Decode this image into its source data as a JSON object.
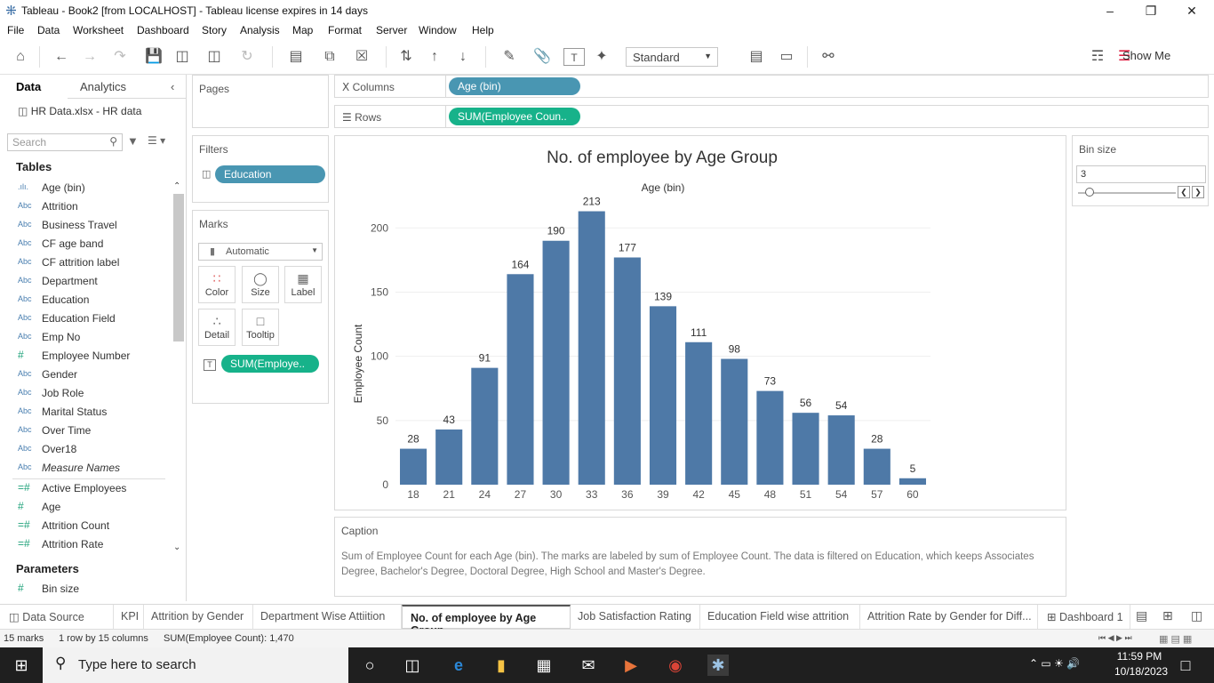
{
  "window": {
    "title": "Tableau - Book2 [from LOCALHOST] - Tableau license expires in 14 days"
  },
  "menu": [
    "File",
    "Data",
    "Worksheet",
    "Dashboard",
    "Story",
    "Analysis",
    "Map",
    "Format",
    "Server",
    "Window",
    "Help"
  ],
  "toolbar": {
    "fit": "Standard",
    "show_me": "Show Me"
  },
  "data_pane": {
    "tabs": {
      "data": "Data",
      "analytics": "Analytics"
    },
    "datasource": "HR Data.xlsx - HR data",
    "search_placeholder": "Search",
    "tables_heading": "Tables",
    "fields": [
      {
        "type": ".ılı.",
        "name": "Age (bin)"
      },
      {
        "type": "Abc",
        "name": "Attrition"
      },
      {
        "type": "Abc",
        "name": "Business Travel"
      },
      {
        "type": "Abc",
        "name": "CF age band"
      },
      {
        "type": "Abc",
        "name": "CF attrition label"
      },
      {
        "type": "Abc",
        "name": "Department"
      },
      {
        "type": "Abc",
        "name": "Education"
      },
      {
        "type": "Abc",
        "name": "Education Field"
      },
      {
        "type": "Abc",
        "name": "Emp No"
      },
      {
        "type": "#",
        "name": "Employee Number"
      },
      {
        "type": "Abc",
        "name": "Gender"
      },
      {
        "type": "Abc",
        "name": "Job Role"
      },
      {
        "type": "Abc",
        "name": "Marital Status"
      },
      {
        "type": "Abc",
        "name": "Over Time"
      },
      {
        "type": "Abc",
        "name": "Over18"
      },
      {
        "type": "Abc",
        "name": "Measure Names"
      }
    ],
    "measures": [
      {
        "type": "=#",
        "name": "Active Employees"
      },
      {
        "type": "#",
        "name": "Age"
      },
      {
        "type": "=#",
        "name": "Attrition Count"
      },
      {
        "type": "=#",
        "name": "Attrition Rate"
      }
    ],
    "parameters_heading": "Parameters",
    "parameters": [
      {
        "type": "#",
        "name": "Bin size"
      }
    ]
  },
  "cards": {
    "pages": "Pages",
    "filters": "Filters",
    "filter_pill": "Education",
    "marks": "Marks",
    "mark_type": "Automatic",
    "mark_buttons": {
      "color": "Color",
      "size": "Size",
      "label": "Label",
      "detail": "Detail",
      "tooltip": "Tooltip"
    },
    "label_pill": "SUM(Employe.."
  },
  "shelves": {
    "columns_label": "Columns",
    "columns_pill": "Age (bin)",
    "rows_label": "Rows",
    "rows_pill": "SUM(Employee Coun.."
  },
  "bin_param": {
    "title": "Bin size",
    "value": "3"
  },
  "caption": {
    "title": "Caption",
    "text": "Sum of Employee Count for each Age (bin).  The marks are labeled by sum of Employee Count. The data is filtered on Education, which keeps Associates Degree, Bachelor's Degree, Doctoral Degree, High School and Master's Degree."
  },
  "chart_data": {
    "type": "bar",
    "title": "No. of employee by Age Group",
    "xlabel": "Age (bin)",
    "ylabel": "Employee Count",
    "categories": [
      "18",
      "21",
      "24",
      "27",
      "30",
      "33",
      "36",
      "39",
      "42",
      "45",
      "48",
      "51",
      "54",
      "57",
      "60"
    ],
    "values": [
      28,
      43,
      91,
      164,
      190,
      213,
      177,
      139,
      111,
      98,
      73,
      56,
      54,
      28,
      5
    ],
    "yticks": [
      0,
      50,
      100,
      150,
      200
    ],
    "ylim": [
      0,
      230
    ],
    "color": "#4e79a7",
    "grid": true
  },
  "sheet_tabs": [
    "Data Source",
    "KPI",
    "Attrition by Gender",
    "Department Wise Attiition",
    "No. of employee by Age Group",
    "Job Satisfaction Rating",
    "Education Field wise attrition",
    "Attrition Rate by Gender for Diff...",
    "Dashboard 1"
  ],
  "active_tab": "No. of employee by Age Group",
  "status": {
    "marks": "15 marks",
    "dims": "1 row by 15 columns",
    "sum": "SUM(Employee Count): 1,470"
  },
  "taskbar": {
    "search_placeholder": "Type here to search",
    "time": "11:59 PM",
    "date": "10/18/2023"
  }
}
